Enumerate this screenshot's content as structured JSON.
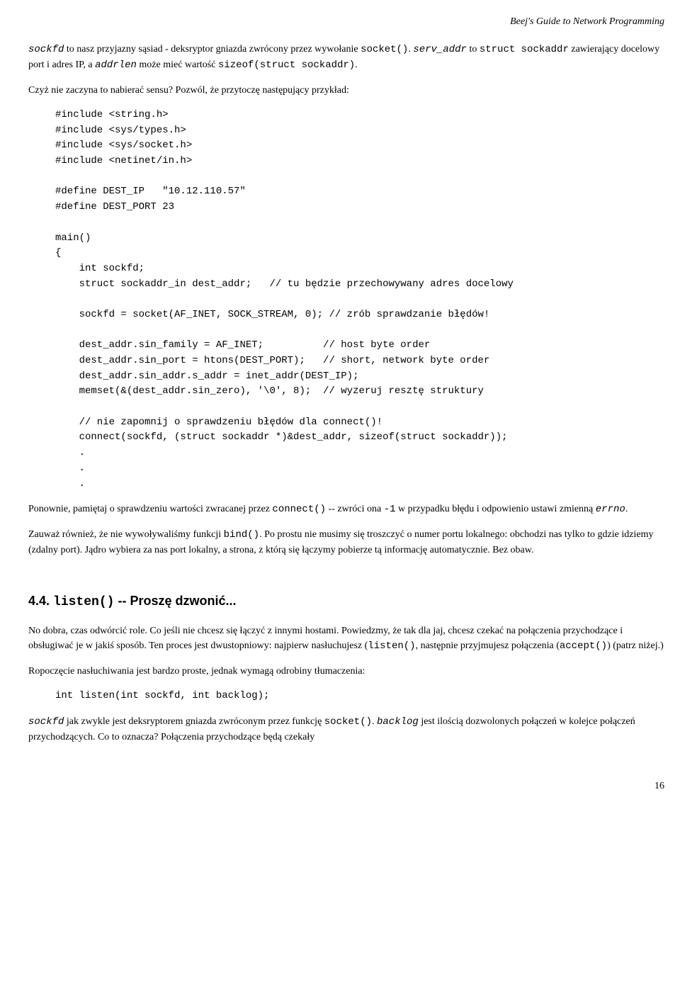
{
  "header": {
    "title": "Beej's Guide to Network Programming"
  },
  "para1": {
    "t1": "sockfd",
    "t2": " to nasz przyjazny sąsiad - deksryptor gniazda zwrócony przez wywołanie ",
    "t3": "socket()",
    "t4": ". ",
    "t5": "serv_addr",
    "t6": " to ",
    "t7": "struct sockaddr",
    "t8": " zawierający docelowy port i adres IP, a ",
    "t9": "addrlen",
    "t10": " może mieć wartość ",
    "t11": "sizeof(struct sockaddr)",
    "t12": "."
  },
  "para2": "Czyż nie zaczyna to nabierać sensu? Pozwól, że przytoczę następujący przykład:",
  "code1": "#include <string.h>\n#include <sys/types.h>\n#include <sys/socket.h>\n#include <netinet/in.h>\n\n#define DEST_IP   \"10.12.110.57\"\n#define DEST_PORT 23\n\nmain()\n{\n    int sockfd;\n    struct sockaddr_in dest_addr;   // tu będzie przechowywany adres docelowy\n\n    sockfd = socket(AF_INET, SOCK_STREAM, 0); // zrób sprawdzanie błędów!\n\n    dest_addr.sin_family = AF_INET;          // host byte order\n    dest_addr.sin_port = htons(DEST_PORT);   // short, network byte order\n    dest_addr.sin_addr.s_addr = inet_addr(DEST_IP);\n    memset(&(dest_addr.sin_zero), '\\0', 8);  // wyzeruj resztę struktury\n\n    // nie zapomnij o sprawdzeniu błędów dla connect()!\n    connect(sockfd, (struct sockaddr *)&dest_addr, sizeof(struct sockaddr));\n    .\n    .\n    .",
  "para3": {
    "t1": "Ponownie, pamiętaj o sprawdzeniu wartości zwracanej przez ",
    "t2": "connect()",
    "t3": " -- zwróci ona ",
    "t4": "-1",
    "t5": " w przypadku błędu i odpowienio ustawi zmienną ",
    "t6": "errno",
    "t7": "."
  },
  "para4": {
    "t1": "Zauważ również, że nie wywoływaliśmy funkcji ",
    "t2": "bind()",
    "t3": ". Po prostu nie musimy się troszczyć o numer portu lokalnego: obchodzi nas tylko to gdzie idziemy (zdalny port). Jądro wybiera za nas port lokalny, a strona, z którą się łączymy pobierze tą informację automatycznie. Bez obaw."
  },
  "section": {
    "num": "4.4. ",
    "code": "listen()",
    "rest": " -- Proszę dzwonić..."
  },
  "para5": {
    "t1": "No dobra, czas odwórcić role. Co jeśli nie chcesz się łączyć z innymi hostami. Powiedzmy, że tak dla jaj, chcesz czekać na połączenia przychodzące i obsługiwać je w jakiś sposób. Ten proces jest dwustopniowy: najpierw nasłuchujesz (",
    "t2": "listen()",
    "t3": ", następnie przyjmujesz połączenia (",
    "t4": "accept()",
    "t5": ") (patrz niżej.)"
  },
  "para6": "Ropoczęcie nasłuchiwania jest bardzo proste, jednak wymagą odrobiny tłumaczenia:",
  "code2": "int listen(int sockfd, int backlog);",
  "para7": {
    "t1": "sockfd",
    "t2": " jak zwykle jest deksryptorem gniazda zwróconym przez funkcję ",
    "t3": "socket()",
    "t4": ". ",
    "t5": "backlog",
    "t6": " jest ilością dozwolonych połączeń w kolejce połączeń przychodzących. Co to oznacza? Połączenia przychodzące będą czekały"
  },
  "pagenum": "16"
}
